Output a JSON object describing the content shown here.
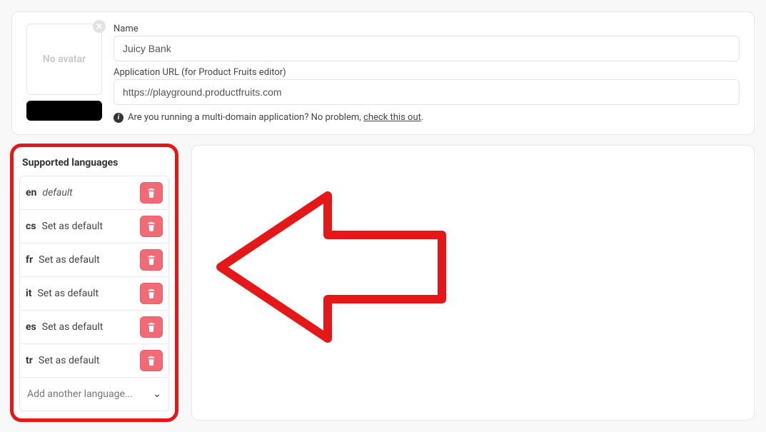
{
  "avatar": {
    "placeholder_text": "No avatar"
  },
  "form": {
    "name_label": "Name",
    "name_value": "Juicy Bank",
    "url_label": "Application URL (for Product Fruits editor)",
    "url_value": "https://playground.productfruits.com",
    "helper_text": "Are you running a multi-domain application? No problem, ",
    "helper_link": "check this out",
    "helper_suffix": "."
  },
  "languages": {
    "title": "Supported languages",
    "default_label": "default",
    "set_default_label": "Set as default",
    "add_placeholder": "Add another language...",
    "items": [
      {
        "code": "en",
        "is_default": true
      },
      {
        "code": "cs",
        "is_default": false
      },
      {
        "code": "fr",
        "is_default": false
      },
      {
        "code": "it",
        "is_default": false
      },
      {
        "code": "es",
        "is_default": false
      },
      {
        "code": "tr",
        "is_default": false
      }
    ]
  },
  "colors": {
    "highlight": "#e41818",
    "trash": "#f16b77"
  }
}
